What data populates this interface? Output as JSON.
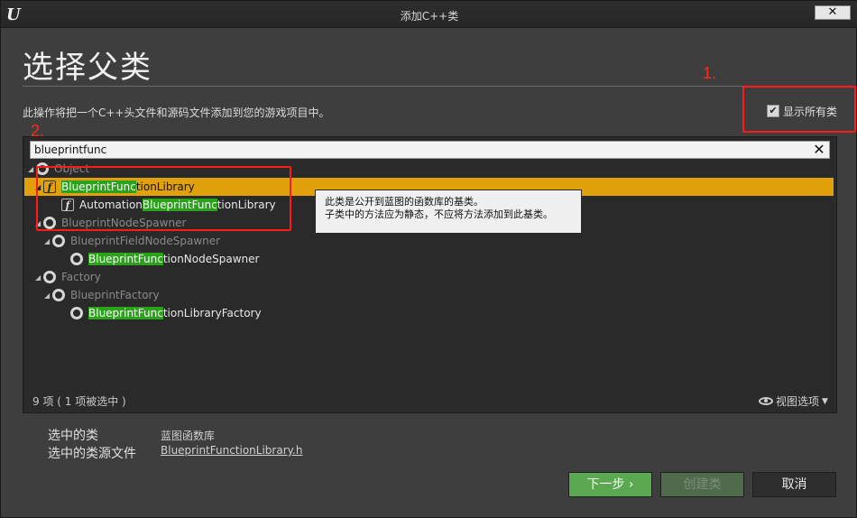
{
  "window": {
    "title": "添加C++类",
    "logo": "U",
    "close_label": "✕"
  },
  "header": {
    "heading": "选择父类",
    "description": "此操作将把一个C++头文件和源码文件添加到您的游戏项目中。",
    "show_all_label": "显示所有类",
    "show_all_checked": true
  },
  "annotations": {
    "one": "1.",
    "two": "2."
  },
  "search": {
    "value": "blueprintfunc",
    "clear_label": "✕",
    "highlight_color": "#2aa31a"
  },
  "tree": [
    {
      "pre": "",
      "match": "",
      "post": "Object",
      "label": "Object",
      "icon": "class-circle-icon",
      "style": "dim",
      "expanded": true
    },
    {
      "pre": "",
      "match": "BlueprintFunc",
      "post": "tionLibrary",
      "label": "BlueprintFunctionLibrary",
      "icon": "function-library-icon",
      "style": "dark",
      "selected": true
    },
    {
      "pre": "Automation",
      "match": "BlueprintFunc",
      "post": "tionLibrary",
      "label": "AutomationBlueprintFunctionLibrary",
      "icon": "function-library-icon",
      "style": "bright"
    },
    {
      "pre": "",
      "match": "",
      "post": "BlueprintNodeSpawner",
      "label": "BlueprintNodeSpawner",
      "icon": "class-circle-icon",
      "style": "dim",
      "expanded": true
    },
    {
      "pre": "",
      "match": "",
      "post": "BlueprintFieldNodeSpawner",
      "label": "BlueprintFieldNodeSpawner",
      "icon": "class-circle-icon",
      "style": "dim",
      "expanded": true
    },
    {
      "pre": "",
      "match": "BlueprintFunc",
      "post": "tionNodeSpawner",
      "label": "BlueprintFunctionNodeSpawner",
      "icon": "class-circle-icon",
      "style": "bright"
    },
    {
      "pre": "",
      "match": "",
      "post": "Factory",
      "label": "Factory",
      "icon": "class-circle-icon",
      "style": "dim",
      "expanded": true
    },
    {
      "pre": "",
      "match": "",
      "post": "BlueprintFactory",
      "label": "BlueprintFactory",
      "icon": "class-circle-icon",
      "style": "dim",
      "expanded": true
    },
    {
      "pre": "",
      "match": "BlueprintFunc",
      "post": "tionLibraryFactory",
      "label": "BlueprintFunctionLibraryFactory",
      "icon": "class-circle-icon",
      "style": "bright"
    }
  ],
  "tooltip": {
    "line1": "此类是公开到蓝图的函数库的基类。",
    "line2": "子类中的方法应为静态，不应将方法添加到此基类。"
  },
  "footer_bar": {
    "count": "9 项 ( 1 项被选中 )",
    "view_options": "视图选项"
  },
  "selection_info": {
    "class_label": "选中的类",
    "class_value": "蓝图函数库",
    "source_label": "选中的类源文件",
    "source_value": "BlueprintFunctionLibrary.h"
  },
  "buttons": {
    "next": "下一步",
    "next_arrow": "›",
    "create": "创建类",
    "cancel": "取消"
  },
  "colors": {
    "selected_row": "#e0a10a",
    "next_button": "#5aa850",
    "annotation": "#ff1a1a"
  }
}
